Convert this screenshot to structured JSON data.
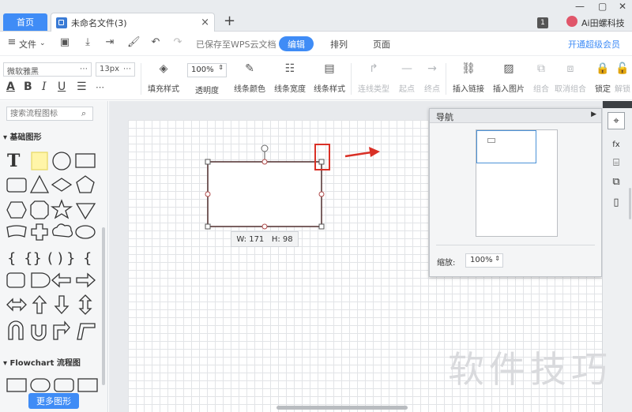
{
  "titlebar": {
    "home_tab": "首页",
    "doc_tab": "未命名文件(3)",
    "close": "×",
    "new_tab": "+",
    "badge": "1",
    "user_name": "Ai田螺科技",
    "window_controls": [
      "—",
      "▢",
      "✕"
    ]
  },
  "menubar": {
    "file": "文件",
    "saved_status": "已保存至WPS云文档",
    "edit": "编辑",
    "arrange": "排列",
    "page": "页面",
    "upgrade": "开通超级会员"
  },
  "toolbar": {
    "font": "微软雅黑",
    "font_size": "13px",
    "fill_style": "填充样式",
    "opacity_value": "100%",
    "opacity": "透明度",
    "line_color": "线条颜色",
    "line_width": "线条宽度",
    "line_style": "线条样式",
    "connector_type": "连线类型",
    "start_point": "起点",
    "end_point": "终点",
    "insert_link": "插入链接",
    "insert_image": "插入图片",
    "group": "组合",
    "ungroup": "取消组合",
    "lock": "锁定",
    "unlock": "解锁"
  },
  "left_panel": {
    "search_placeholder": "搜索流程图标",
    "category_basic": "基础图形",
    "category_flowchart": "Flowchart 流程图",
    "more_shapes": "更多图形"
  },
  "canvas": {
    "size_label": "W: 171   H: 98",
    "highlight_color": "#d93026"
  },
  "navigator": {
    "title": "导航",
    "zoom_label": "缩放:",
    "zoom_value": "100%"
  },
  "watermark": "软件技巧"
}
